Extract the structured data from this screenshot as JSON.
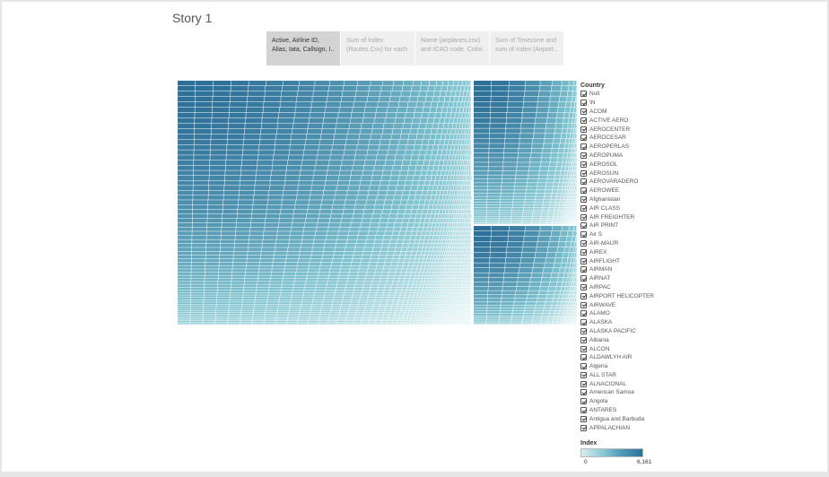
{
  "story": {
    "title": "Story 1"
  },
  "story_points": [
    {
      "line1": "Active, Airline ID,",
      "line2": "Alias, Iata, Callsign, I..",
      "active": true
    },
    {
      "line1": "Sum of Index",
      "line2": "(Routes.Csv) for each ..",
      "active": false
    },
    {
      "line1": "Name (airplanes.csv)",
      "line2": "and ICAO code.  Color..",
      "active": false
    },
    {
      "line1": "Sum of Timezone and",
      "line2": "sum of Index (Airport..",
      "active": false
    }
  ],
  "treemap": {
    "colors": {
      "light": "#e6f5f4",
      "mid": "#7fc3d0",
      "dark": "#2d6f98",
      "grid": "#ffffff"
    }
  },
  "legend": {
    "title": "Country",
    "items": [
      "Null",
      "\\N",
      "ACOM",
      "ACTIVE AERO",
      "AEROCENTER",
      "AEROCESAR",
      "AEROPERLAS",
      "AEROPUMA",
      "AEROSOL",
      "AEROSUN",
      "AEROVARADERO",
      "AEROWEE",
      "Afghanistan",
      "AIR CLASS",
      "AIR FREIGHTER",
      "AIR PRINT",
      "Air S",
      "AIR-MAUR",
      "AIREX",
      "AIRFLIGHT",
      "AIRMAN",
      "AIRNAT",
      "AIRPAC",
      "AIRPORT HELICOPTER",
      "AIRWAVE",
      "ALAMO",
      "ALASKA",
      "ALASKA PACIFIC",
      "Albania",
      "ALCON",
      "ALDAWLYH AIR",
      "Algeria",
      "ALL STAR",
      "ALNACIONAL",
      "American Samoa",
      "Angola",
      "ANTARES",
      "Antigua and Barbuda",
      "APPALACHIAN"
    ]
  },
  "color_legend": {
    "title": "Index",
    "min": "0",
    "max": "6,161"
  }
}
